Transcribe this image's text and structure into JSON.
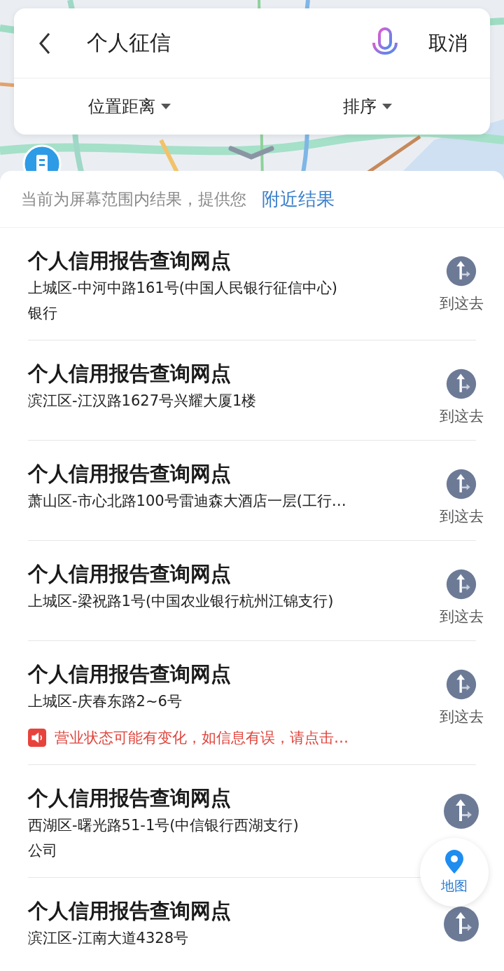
{
  "search": {
    "value": "个人征信",
    "cancel": "取消"
  },
  "filters": [
    {
      "label": "位置距离"
    },
    {
      "label": "排序"
    }
  ],
  "notice_bar": {
    "text": "当前为屏幕范围内结果，提供您",
    "link": "附近结果"
  },
  "results": [
    {
      "title": "个人信用报告查询网点",
      "address": "上城区-中河中路161号(中国人民银行征信中心)",
      "category": "银行",
      "action": "到这去"
    },
    {
      "title": "个人信用报告查询网点",
      "address": "滨江区-江汉路1627号兴耀大厦1楼",
      "action": "到这去"
    },
    {
      "title": "个人信用报告查询网点",
      "address": "萧山区-市心北路100号雷迪森大酒店一层(工行…",
      "action": "到这去"
    },
    {
      "title": "个人信用报告查询网点",
      "address": "上城区-梁祝路1号(中国农业银行杭州江锦支行)",
      "action": "到这去"
    },
    {
      "title": "个人信用报告查询网点",
      "address": "上城区-庆春东路2~6号",
      "warning": "营业状态可能有变化，如信息有误，请点击…",
      "action": "到这去"
    },
    {
      "title": "个人信用报告查询网点",
      "address": "西湖区-曙光路51-1号(中信银行西湖支行)",
      "category": "公司"
    },
    {
      "title": "个人信用报告查询网点",
      "address": "滨江区-江南大道4328号"
    }
  ],
  "map_button": {
    "label": "地图"
  }
}
